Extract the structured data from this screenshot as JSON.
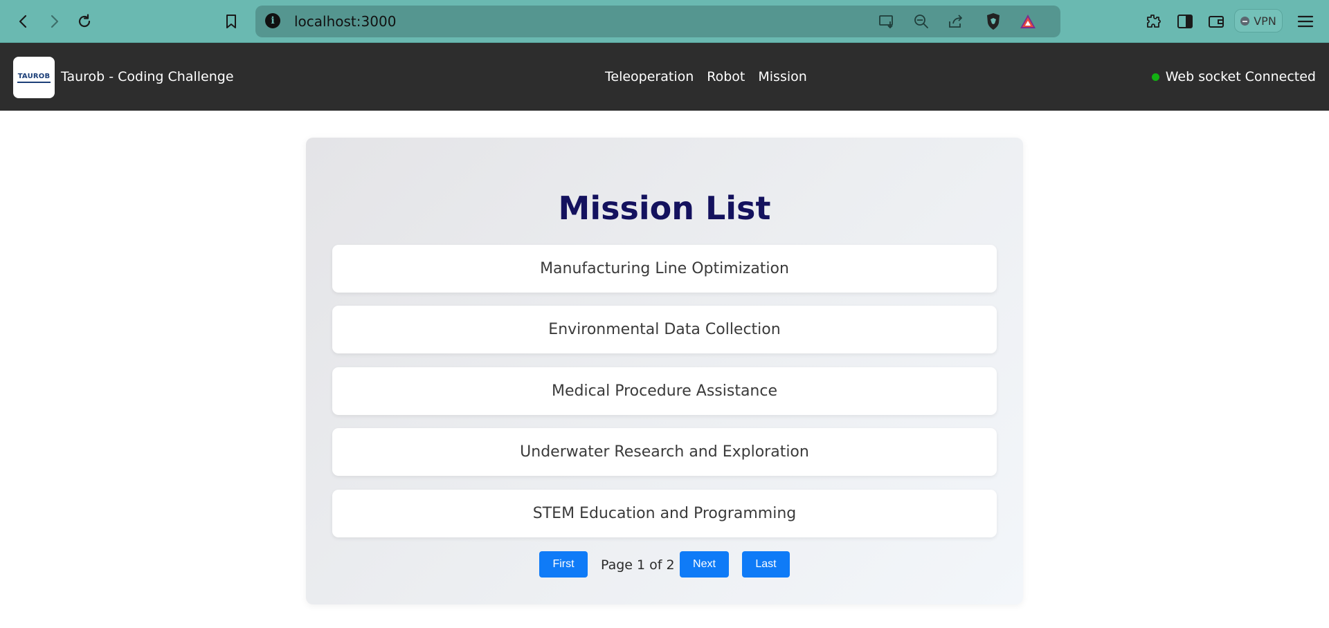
{
  "browser": {
    "url": "localhost:3000",
    "vpn_label": "VPN"
  },
  "navbar": {
    "logo_text": "TAUROB",
    "brand": "Taurob - Coding Challenge",
    "links": [
      {
        "label": "Teleoperation"
      },
      {
        "label": "Robot"
      },
      {
        "label": "Mission"
      }
    ],
    "status": {
      "label": "Web socket Connected",
      "color": "#12b012"
    }
  },
  "main": {
    "title": "Mission List",
    "missions": [
      {
        "name": "Manufacturing Line Optimization"
      },
      {
        "name": "Environmental Data Collection"
      },
      {
        "name": "Medical Procedure Assistance"
      },
      {
        "name": "Underwater Research and Exploration"
      },
      {
        "name": "STEM Education and Programming"
      }
    ],
    "pagination": {
      "first": "First",
      "info": "Page 1 of 2",
      "next": "Next",
      "last": "Last",
      "current_page": 1,
      "total_pages": 2
    }
  },
  "colors": {
    "chrome": "#6ab9b1",
    "navbar": "#2d2d2d",
    "title": "#14125e",
    "button": "#0f7bf7"
  }
}
